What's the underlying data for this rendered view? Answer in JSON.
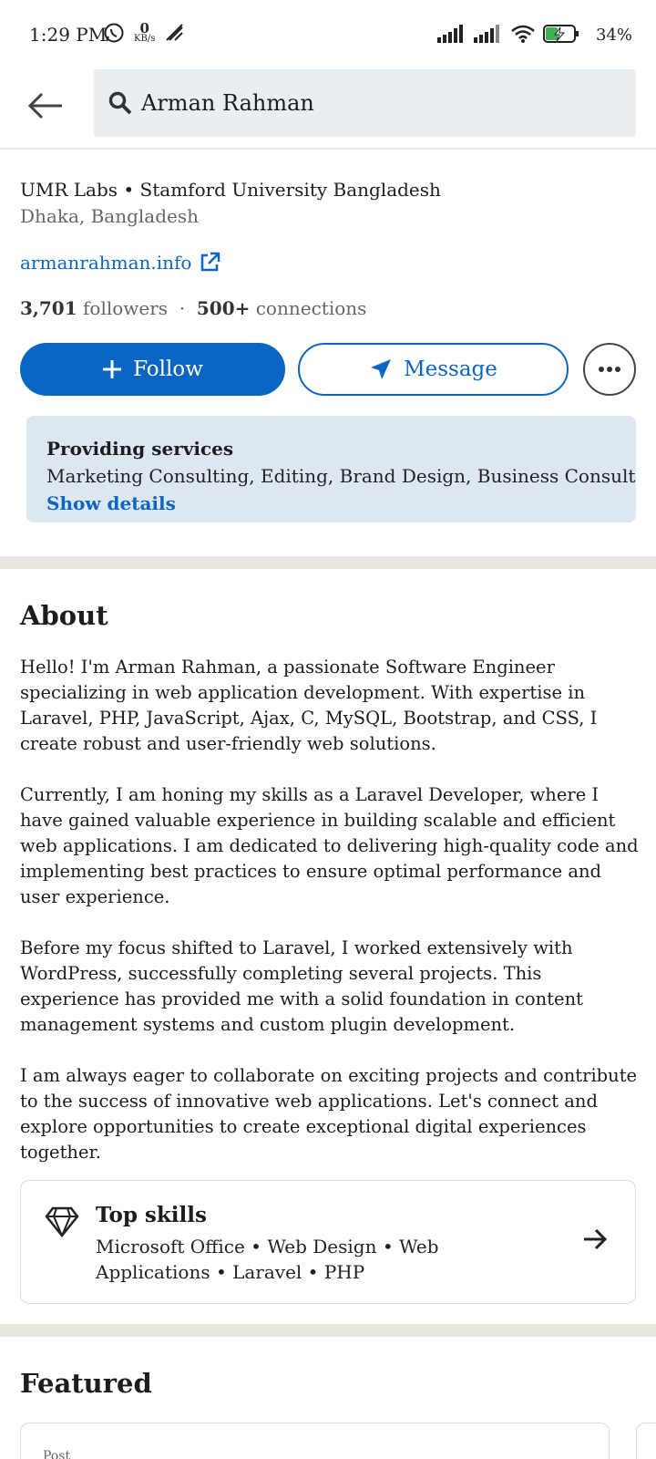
{
  "status_bar": {
    "time": "1:29 PM",
    "net_speed_value": "0",
    "net_speed_unit": "KB/s",
    "battery": "34%"
  },
  "header": {
    "search_text": "Arman Rahman"
  },
  "profile": {
    "company": "UMR Labs • Stamford University Bangladesh",
    "location": "Dhaka, Bangladesh",
    "website": "armanrahman.info",
    "followers_count": "3,701",
    "followers_label": "followers",
    "connections_count": "500+",
    "connections_label": "connections"
  },
  "actions": {
    "follow_label": "Follow",
    "message_label": "Message"
  },
  "services": {
    "title": "Providing services",
    "list": "Marketing Consulting, Editing, Brand Design, Business Consulting...",
    "link": "Show details"
  },
  "about": {
    "title": "About",
    "paragraphs": [
      "Hello! I'm Arman Rahman, a passionate Software Engineer specializing in web application development. With expertise in Laravel, PHP, JavaScript, Ajax, C, MySQL, Bootstrap, and CSS, I create robust and user-friendly web solutions.",
      "Currently, I am honing my skills as a Laravel Developer, where I have gained valuable experience in building scalable and efficient web applications. I am dedicated to delivering high-quality code and implementing best practices to ensure optimal performance and user experience.",
      "Before my focus shifted to Laravel, I worked extensively with WordPress, successfully completing several projects. This experience has provided me with a solid foundation in content management systems and custom plugin development.",
      "I am always eager to collaborate on exciting projects and contribute to the success of innovative web applications. Let's connect and explore opportunities to create exceptional digital experiences together."
    ]
  },
  "top_skills": {
    "title": "Top skills",
    "list": "Microsoft Office • Web Design • Web Applications • Laravel • PHP"
  },
  "featured": {
    "title": "Featured",
    "card_label": "Post"
  },
  "colors": {
    "brand": "#0a66c2",
    "services_bg": "#dde7f1",
    "search_bg": "#e9eef3",
    "divider": "#e8e6df"
  }
}
